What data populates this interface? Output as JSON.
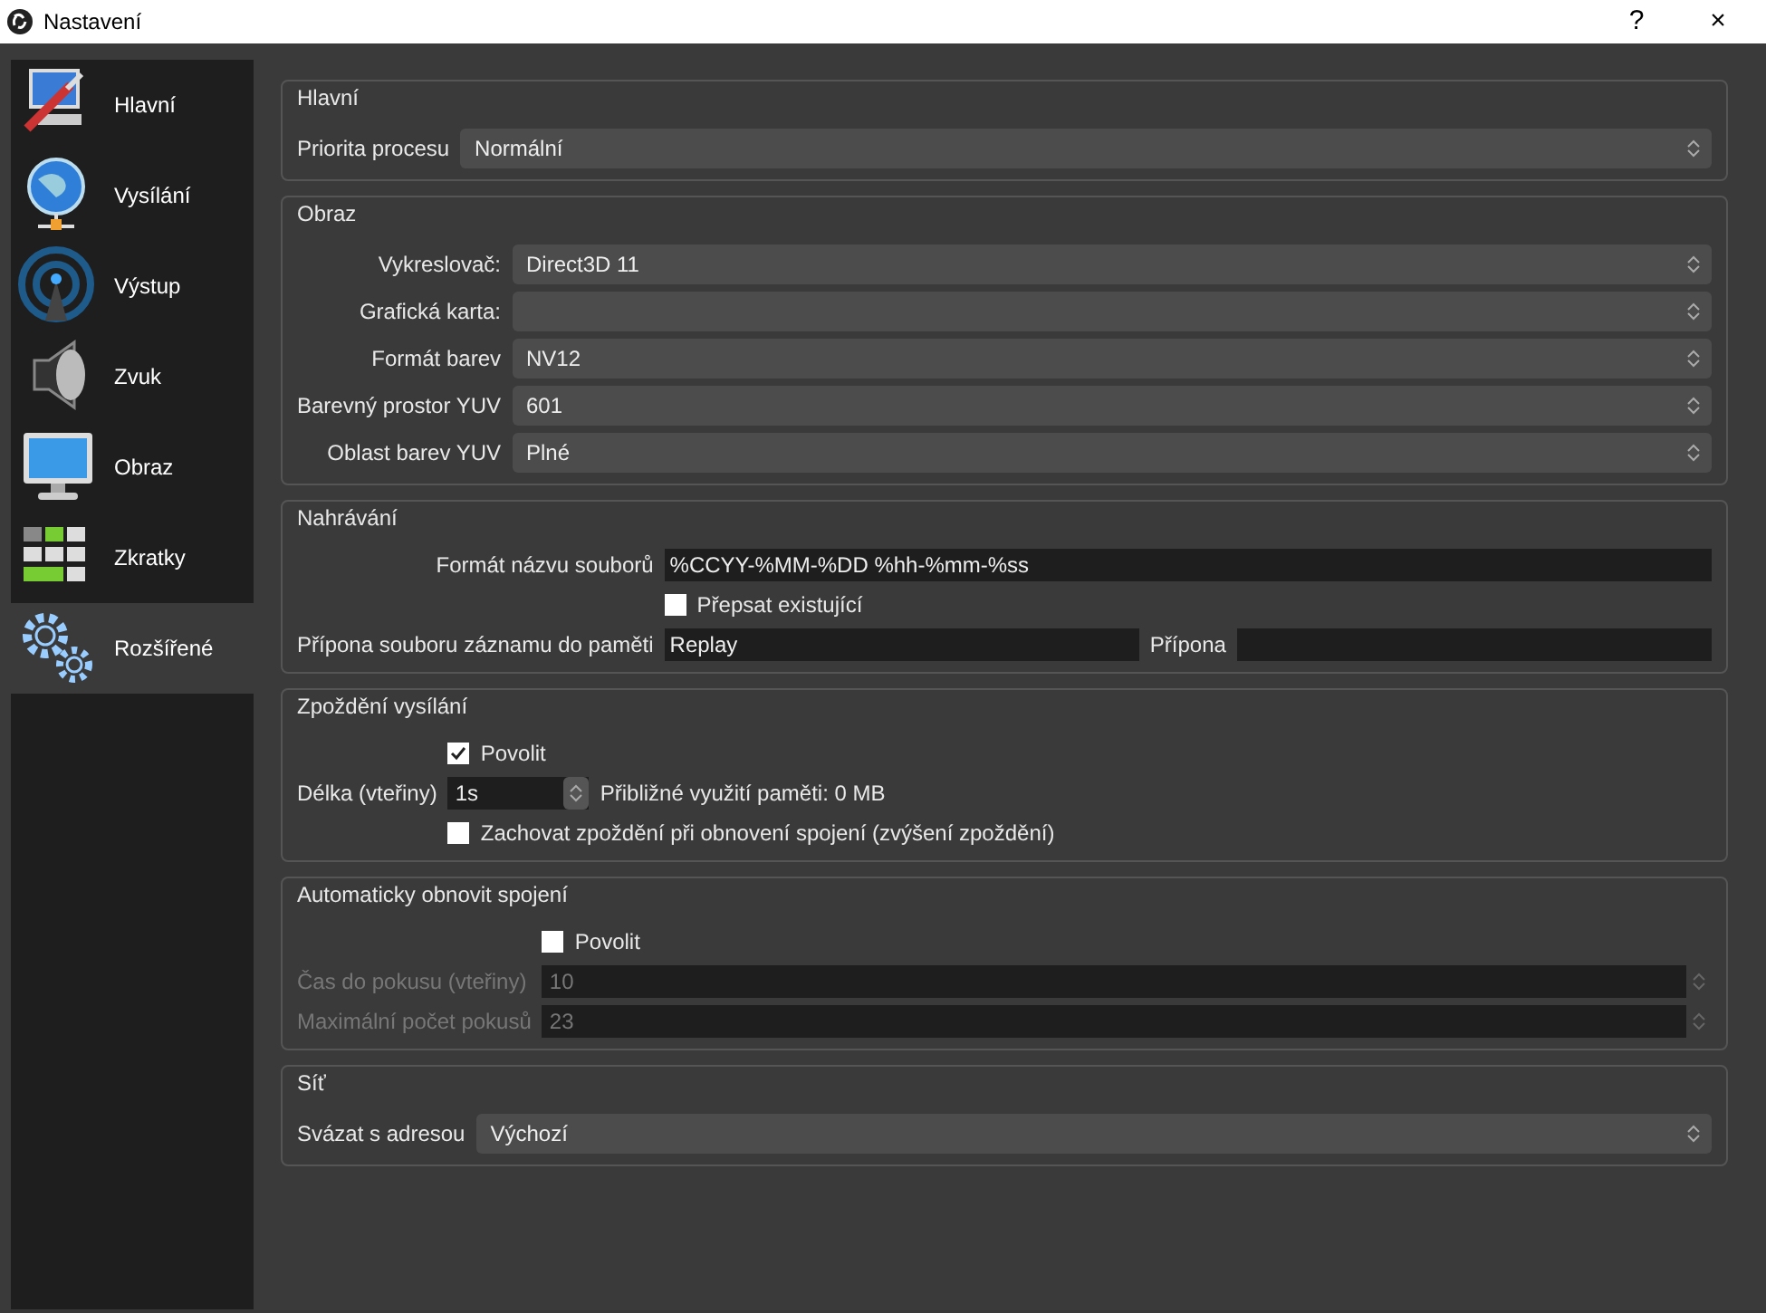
{
  "window": {
    "title": "Nastavení",
    "buttons": [
      "?",
      "×"
    ]
  },
  "sidebar": {
    "items": [
      {
        "label": "Hlavní",
        "selected": false
      },
      {
        "label": "Vysílání",
        "selected": false
      },
      {
        "label": "Výstup",
        "selected": false
      },
      {
        "label": "Zvuk",
        "selected": false
      },
      {
        "label": "Obraz",
        "selected": false
      },
      {
        "label": "Zkratky",
        "selected": false
      },
      {
        "label": "Rozšířené",
        "selected": true
      }
    ]
  },
  "groups": [
    {
      "title": "Hlavní",
      "rows": [
        {
          "kind": "combo",
          "label": "Priorita procesu",
          "value": "Normální"
        }
      ]
    },
    {
      "title": "Obraz",
      "rows": [
        {
          "kind": "combo",
          "label": "Vykreslovač:",
          "value": "Direct3D 11"
        },
        {
          "kind": "combo",
          "label": "Grafická karta:"
        },
        {
          "kind": "combo",
          "label": "Formát barev",
          "value": "NV12"
        },
        {
          "kind": "combo",
          "label": "Barevný prostor YUV",
          "value": "601"
        },
        {
          "kind": "combo",
          "label": "Oblast barev YUV",
          "value": "Plné"
        }
      ]
    },
    {
      "title": "Nahrávání",
      "rows": [
        {
          "kind": "text",
          "label": "Formát názvu souborů",
          "value": "%CCYY-%MM-%DD %hh-%mm-%ss"
        },
        {
          "kind": "checkbox",
          "label": "Přepsat existující",
          "checked": false
        },
        {
          "kind": "text",
          "label": "Přípona souboru záznamu do paměti",
          "value": "Replay",
          "suffix_label": "Přípona"
        }
      ]
    },
    {
      "title": "Zpoždění vysílání",
      "rows": [
        {
          "kind": "checkbox",
          "label": "Povolit",
          "checked": true
        },
        {
          "kind": "spin",
          "label": "Délka (vteřiny)",
          "value": "1s",
          "note": "Přibližné využití paměti: 0 MB",
          "disabled": false
        },
        {
          "kind": "checkbox",
          "label": "Zachovat zpoždění při obnovení spojení (zvýšení zpoždění)",
          "checked": false
        }
      ]
    },
    {
      "title": "Automaticky obnovit spojení",
      "rows": [
        {
          "kind": "checkbox",
          "label": "Povolit",
          "checked": false
        },
        {
          "kind": "spin",
          "label": "Čas do pokusu (vteřiny)",
          "value": "10",
          "disabled": true
        },
        {
          "kind": "spin",
          "label": "Maximální počet pokusů",
          "value": "23",
          "disabled": true
        }
      ]
    },
    {
      "title": "Síť",
      "rows": [
        {
          "kind": "combo",
          "label": "Svázat s adresou",
          "value": "Výchozí"
        }
      ]
    }
  ]
}
